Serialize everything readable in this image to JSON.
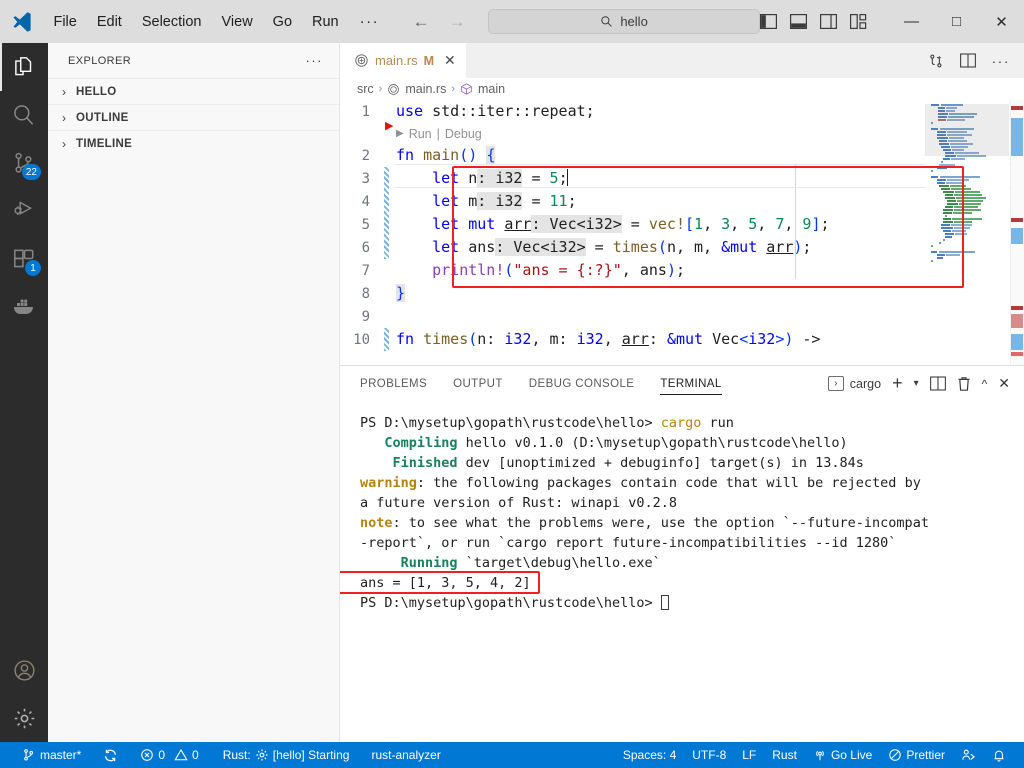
{
  "titlebar": {
    "logo_icon": "vscode-logo-icon",
    "menus": [
      "File",
      "Edit",
      "Selection",
      "View",
      "Go",
      "Run"
    ],
    "more_label": "···",
    "back_icon": "arrow-left-icon",
    "forward_icon": "arrow-right-icon",
    "command_center": {
      "icon": "search-icon",
      "value": "hello",
      "placeholder": "Search"
    },
    "layout_icons": [
      "toggle-primary-sidebar-icon",
      "toggle-panel-icon",
      "toggle-secondary-sidebar-icon",
      "customize-layout-icon"
    ],
    "window_controls": {
      "minimize": "—",
      "maximize": "□",
      "close": "✕"
    }
  },
  "activitybar": {
    "items": [
      {
        "name": "explorer",
        "icon": "files-icon",
        "badge": ""
      },
      {
        "name": "search",
        "icon": "search-icon",
        "badge": ""
      },
      {
        "name": "source-control",
        "icon": "source-control-icon",
        "badge": "22"
      },
      {
        "name": "run-and-debug",
        "icon": "run-debug-icon",
        "badge": ""
      },
      {
        "name": "extensions",
        "icon": "extensions-icon",
        "badge": "1"
      },
      {
        "name": "docker",
        "icon": "docker-whale-icon",
        "badge": ""
      }
    ],
    "bottom": [
      {
        "name": "accounts",
        "icon": "account-icon"
      },
      {
        "name": "manage",
        "icon": "gear-icon"
      }
    ]
  },
  "sidebar": {
    "title": "EXPLORER",
    "more_actions": "···",
    "sections": [
      {
        "label": "HELLO",
        "chevron": "›",
        "expanded": false
      },
      {
        "label": "OUTLINE",
        "chevron": "›",
        "expanded": false
      },
      {
        "label": "TIMELINE",
        "chevron": "›",
        "expanded": false
      }
    ]
  },
  "editor": {
    "tab": {
      "icon": "rust-file-icon",
      "filename": "main.rs",
      "modified_badge": "M",
      "close_icon": "✕"
    },
    "tab_actions": [
      "split-source-control-icon",
      "split-editor-icon",
      "more-actions-icon"
    ],
    "breadcrumb": [
      {
        "label": "src",
        "icon": ""
      },
      {
        "label": "main.rs",
        "icon": "rust-file-icon"
      },
      {
        "label": "main",
        "icon": "symbol-function-icon"
      }
    ],
    "breadcrumb_sep": "›",
    "codelens": {
      "run": "Run",
      "sep": "|",
      "debug": "Debug",
      "play_icon": "play-icon"
    },
    "lines": [
      {
        "num": "1",
        "modified": false
      },
      {
        "num": "2",
        "modified": false
      },
      {
        "num": "3",
        "modified": true
      },
      {
        "num": "4",
        "modified": true
      },
      {
        "num": "5",
        "modified": true
      },
      {
        "num": "6",
        "modified": true
      },
      {
        "num": "7",
        "modified": false
      },
      {
        "num": "8",
        "modified": false
      },
      {
        "num": "9",
        "modified": false
      },
      {
        "num": "10",
        "modified": true
      }
    ],
    "source_text": [
      "use std::iter::repeat;",
      "fn main() {",
      "    let n: i32 = 5;",
      "    let m: i32 = 11;",
      "    let mut arr: Vec<i32> = vec![1, 3, 5, 7, 9];",
      "    let ans: Vec<i32> = times(n, m, &mut arr);",
      "    println!(\"ans = {:?}\", ans);",
      "}",
      "",
      "fn times(n: i32, m: i32, arr: &mut Vec<i32>) ->"
    ],
    "highlight_color": "#f02020"
  },
  "panel": {
    "tabs": [
      {
        "label": "PROBLEMS",
        "active": false
      },
      {
        "label": "OUTPUT",
        "active": false
      },
      {
        "label": "DEBUG CONSOLE",
        "active": false
      },
      {
        "label": "TERMINAL",
        "active": true
      }
    ],
    "terminal_name": "cargo",
    "terminal_icon": "chevron-right-box-icon",
    "actions": [
      "new-terminal-icon",
      "terminal-dropdown-icon",
      "split-terminal-icon",
      "kill-terminal-icon",
      "maximize-panel-icon",
      "close-panel-icon"
    ],
    "terminal_lines": [
      {
        "segments": [
          {
            "t": "PS D:\\mysetup\\gopath\\rustcode\\hello> ",
            "c": "plain"
          },
          {
            "t": "cargo",
            "c": "cmd"
          },
          {
            "t": " run",
            "c": "plain"
          }
        ]
      },
      {
        "segments": [
          {
            "t": "   ",
            "c": "plain"
          },
          {
            "t": "Compiling",
            "c": "green"
          },
          {
            "t": " hello v0.1.0 (D:\\mysetup\\gopath\\rustcode\\hello)",
            "c": "plain"
          }
        ]
      },
      {
        "segments": [
          {
            "t": "    ",
            "c": "plain"
          },
          {
            "t": "Finished",
            "c": "green"
          },
          {
            "t": " dev [unoptimized + debuginfo] target(s) in 13.84s",
            "c": "plain"
          }
        ]
      },
      {
        "segments": [
          {
            "t": "warning",
            "c": "yellow"
          },
          {
            "t": ": the following packages contain code that will be rejected by",
            "c": "plain"
          }
        ]
      },
      {
        "segments": [
          {
            "t": "a future version of Rust: winapi v0.2.8",
            "c": "plain"
          }
        ]
      },
      {
        "segments": [
          {
            "t": "note",
            "c": "yellow"
          },
          {
            "t": ": to see what the problems were, use the option `--future-incompat",
            "c": "plain"
          }
        ]
      },
      {
        "segments": [
          {
            "t": "-report`, or run `cargo report future-incompatibilities --id 1280`",
            "c": "plain"
          }
        ]
      },
      {
        "segments": [
          {
            "t": "     ",
            "c": "plain"
          },
          {
            "t": "Running",
            "c": "green"
          },
          {
            "t": " `target\\debug\\hello.exe`",
            "c": "plain"
          }
        ]
      },
      {
        "segments": [
          {
            "t": "ans = [1, 3, 5, 4, 2]",
            "c": "plain"
          }
        ]
      },
      {
        "segments": [
          {
            "t": "PS D:\\mysetup\\gopath\\rustcode\\hello> ",
            "c": "plain"
          }
        ],
        "cursor": true
      }
    ],
    "highlighted_output": "ans = [1, 3, 5, 4, 2]"
  },
  "statusbar": {
    "left": [
      {
        "name": "remote-branch",
        "icon": "source-control-icon",
        "label": "master*"
      },
      {
        "name": "sync",
        "icon": "sync-icon",
        "label": ""
      },
      {
        "name": "problems",
        "icon": "error-warning-icon",
        "label": "0 ⚠ 0",
        "error_count": "0",
        "warning_count": "0"
      },
      {
        "name": "rust-status",
        "icon": "gear-icon",
        "label": "Rust: ⚙ [hello] Starting"
      },
      {
        "name": "rust-analyzer",
        "icon": "",
        "label": "rust-analyzer"
      }
    ],
    "right": [
      {
        "name": "indentation",
        "label": "Spaces: 4"
      },
      {
        "name": "encoding",
        "label": "UTF-8"
      },
      {
        "name": "eol",
        "label": "LF"
      },
      {
        "name": "language-mode",
        "label": "Rust"
      },
      {
        "name": "go-live",
        "icon": "broadcast-icon",
        "label": "Go Live"
      },
      {
        "name": "prettier",
        "icon": "prettier-icon",
        "label": "Prettier"
      },
      {
        "name": "remote-explorer",
        "icon": "remote-icon",
        "label": ""
      },
      {
        "name": "notifications",
        "icon": "bell-icon",
        "label": ""
      }
    ]
  },
  "colors": {
    "accent": "#0078d4",
    "titlebar_bg": "#dddddd",
    "activitybar_bg": "#2c2c2c",
    "sidebar_bg": "#f8f8f8",
    "editor_bg": "#ffffff",
    "highlight": "#f02020",
    "tab_modified": "#b8894a"
  }
}
